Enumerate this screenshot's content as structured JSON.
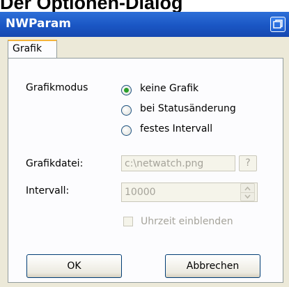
{
  "page": {
    "heading": "Der Optionen-Dialog"
  },
  "window": {
    "title": "NWParam",
    "system_button_icon": "restore-window-icon"
  },
  "tabs": [
    {
      "label": "Grafik",
      "selected": true
    }
  ],
  "grafikmodus": {
    "label": "Grafikmodus",
    "options": [
      {
        "label": "keine Grafik",
        "selected": true
      },
      {
        "label": "bei Statusänderung",
        "selected": false
      },
      {
        "label": "festes Intervall",
        "selected": false
      }
    ]
  },
  "grafikdatei": {
    "label": "Grafikdatei:",
    "value": "c:\\netwatch.png",
    "browse_label": "?",
    "enabled": false
  },
  "intervall": {
    "label": "Intervall:",
    "value": "10000",
    "enabled": false
  },
  "uhrzeit": {
    "label": "Uhrzeit einblenden",
    "checked": false,
    "enabled": false
  },
  "buttons": {
    "ok": "OK",
    "cancel": "Abbrechen"
  },
  "colors": {
    "titlebar": "#1a56c4",
    "dialog_bg": "#ece9d8",
    "radio_dot": "#2a9f2a",
    "tab_highlight": "#f5b43a",
    "disabled_text": "#a5a39a"
  }
}
